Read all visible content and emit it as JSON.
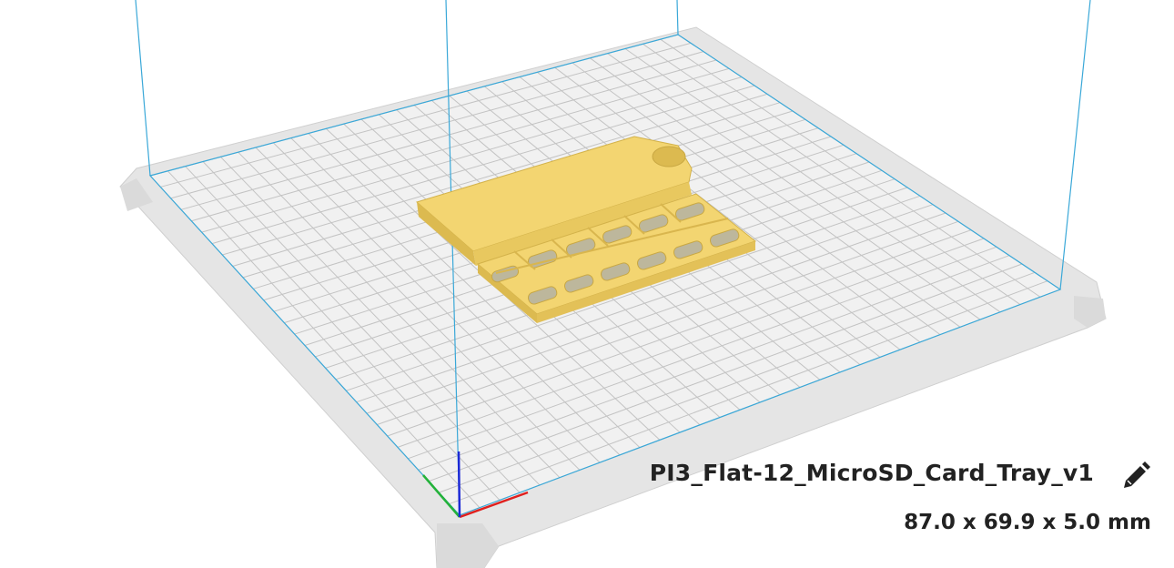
{
  "object_info": {
    "name": "PI3_Flat-12_MicroSD_Card_Tray_v1",
    "dimensions": "87.0 x 69.9 x 5.0 mm"
  },
  "icons": {
    "edit": "pencil-icon"
  },
  "colors": {
    "model": "#f3d571",
    "model_shade": "#dcba50",
    "plate_frame": "#e3e3e3",
    "grid_lines": "#c3c3c3",
    "build_volume": "#3aa8d8",
    "axis_x": "#e0201e",
    "axis_y": "#23b23a",
    "axis_z": "#1d2ad6"
  }
}
